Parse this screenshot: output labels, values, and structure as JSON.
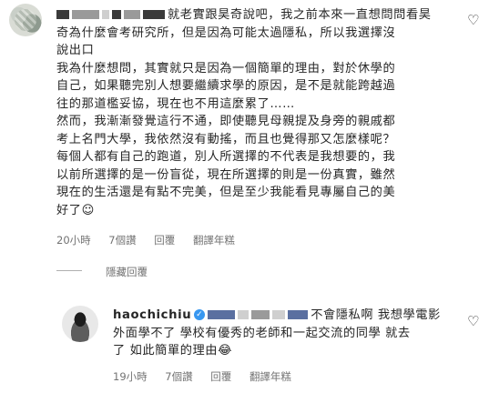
{
  "comment1": {
    "lines": [
      "就老實跟昊奇說吧，我之前本來一直想問問看昊",
      "奇為什麼會考研究所，但是因為可能太過隱私，所以我選擇沒",
      "說出口",
      "我為什麼想問，其實就只是因為一個簡單的理由，對於休學的",
      "自己，如果聽完別人想要繼續求學的原因，是不是就能跨越過",
      "往的那道檻妥協，現在也不用這麼累了……",
      "然而，我漸漸發覺這行不通，即使聽見母親提及身旁的親戚都",
      "考上名門大學，我依然沒有動搖，而且也覺得那又怎麼樣呢？",
      "每個人都有自己的跑道，別人所選擇的不代表是我想要的，我",
      "以前所選擇的是一份盲從，現在所選擇的則是一份真實，雖然",
      "現在的生活還是有點不完美，但是至少我能看見專屬自己的美",
      "好了☺"
    ],
    "time": "20小時",
    "likes": "7個讚",
    "reply": "回覆",
    "translate": "翻譯年糕"
  },
  "hidden_replies": "隱藏回覆",
  "comment2": {
    "username": "haochichiu",
    "text_line1": "不會隱私啊 我想學電影",
    "text_line2": "外面學不了 學校有優秀的老師和一起交流的同學 就去",
    "text_line3": "了 如此簡單的理由😂",
    "time": "19小時",
    "likes": "7個讚",
    "reply": "回覆",
    "translate": "翻譯年糕"
  },
  "icons": {
    "like": "heart-icon",
    "verified": "verified-badge-icon"
  },
  "colors": {
    "text": "#262626",
    "meta": "#737373",
    "verified": "#3897f0"
  }
}
